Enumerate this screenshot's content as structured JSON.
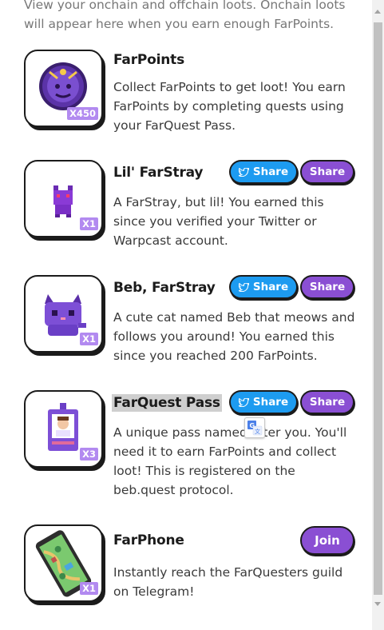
{
  "intro_text": "View your onchain and offchain loots. Onchain loots will appear here when you earn enough FarPoints.",
  "buttons": {
    "twitter_share": "Share",
    "share": "Share",
    "join": "Join"
  },
  "items": [
    {
      "title": "FarPoints",
      "description": "Collect FarPoints to get loot! You earn FarPoints by completing quests using your FarQuest Pass.",
      "badge": "X450",
      "icon": "farpoints-coin-icon"
    },
    {
      "title": "Lil' FarStray",
      "description": "A FarStray, but lil! You earned this since you verified your Twitter or Warpcast account.",
      "badge": "X1",
      "icon": "pixel-cat-small-icon"
    },
    {
      "title": "Beb, FarStray",
      "description": "A cute cat named Beb that meows and follows you around! You earned this since you reached 200 FarPoints.",
      "badge": "X1",
      "icon": "pixel-cat-icon"
    },
    {
      "title": "FarQuest Pass",
      "description": "A unique pass named after you. You'll need it to earn FarPoints and collect loot! This is registered on the beb.quest protocol.",
      "badge": "X3",
      "icon": "id-badge-icon"
    },
    {
      "title": "FarPhone",
      "description": "Instantly reach the FarQuesters guild on Telegram!",
      "badge": "X1",
      "icon": "phone-map-icon"
    }
  ],
  "colors": {
    "twitter_blue": "#1d9bf0",
    "purple": "#8a4fd3",
    "badge_purple": "#b28af0"
  }
}
